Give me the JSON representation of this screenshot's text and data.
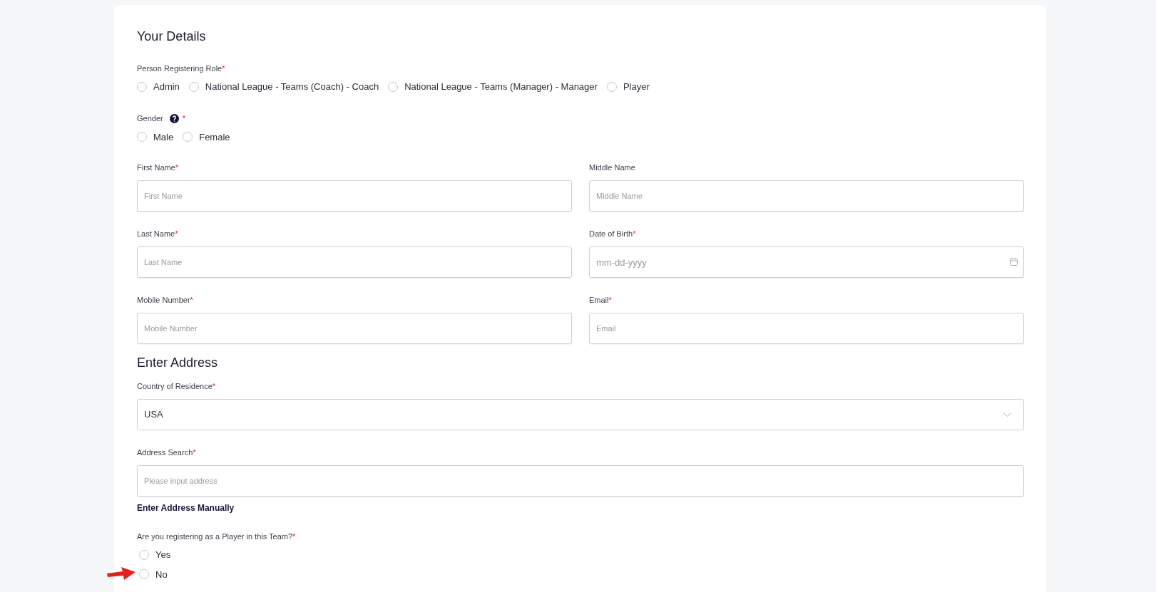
{
  "title": "Your Details",
  "role": {
    "label": "Person Registering Role",
    "required_mark": "*",
    "options": [
      {
        "label": "Admin",
        "selected": false
      },
      {
        "label": "National League - Teams (Coach) - Coach",
        "selected": false
      },
      {
        "label": "National League - Teams (Manager) - Manager",
        "selected": false
      },
      {
        "label": "Player",
        "selected": false
      }
    ]
  },
  "gender": {
    "label": "Gender",
    "required_mark": "*",
    "options": [
      {
        "label": "Male",
        "selected": false
      },
      {
        "label": "Female",
        "selected": false
      }
    ]
  },
  "fields": [
    {
      "label": "First Name",
      "required_mark": "*",
      "placeholder": "First Name",
      "kind": "text"
    },
    {
      "label": "Middle Name",
      "placeholder": "Middle Name",
      "kind": "text"
    },
    {
      "label": "Last Name",
      "required_mark": "*",
      "placeholder": "Last Name",
      "kind": "text"
    },
    {
      "label": "Date of Birth",
      "required_mark": "*",
      "placeholder": "mm-dd-yyyy",
      "kind": "date"
    },
    {
      "label": "Mobile Number",
      "required_mark": "*",
      "placeholder": "Mobile Number",
      "kind": "text"
    },
    {
      "label": "Email",
      "required_mark": "*",
      "placeholder": "Email",
      "kind": "text"
    }
  ],
  "address_heading": "Enter Address",
  "country": {
    "label": "Country of Residence",
    "required_mark": "*",
    "value": "USA"
  },
  "address_search": {
    "label": "Address Search",
    "required_mark": "*",
    "placeholder": "Please input address"
  },
  "manual_link": "Enter Address Manually",
  "player_question": {
    "label": "Are you registering as a Player in this Team?",
    "required_mark": "*",
    "options": [
      {
        "label": "Yes",
        "selected": false
      },
      {
        "label": "No",
        "selected": false
      }
    ]
  }
}
